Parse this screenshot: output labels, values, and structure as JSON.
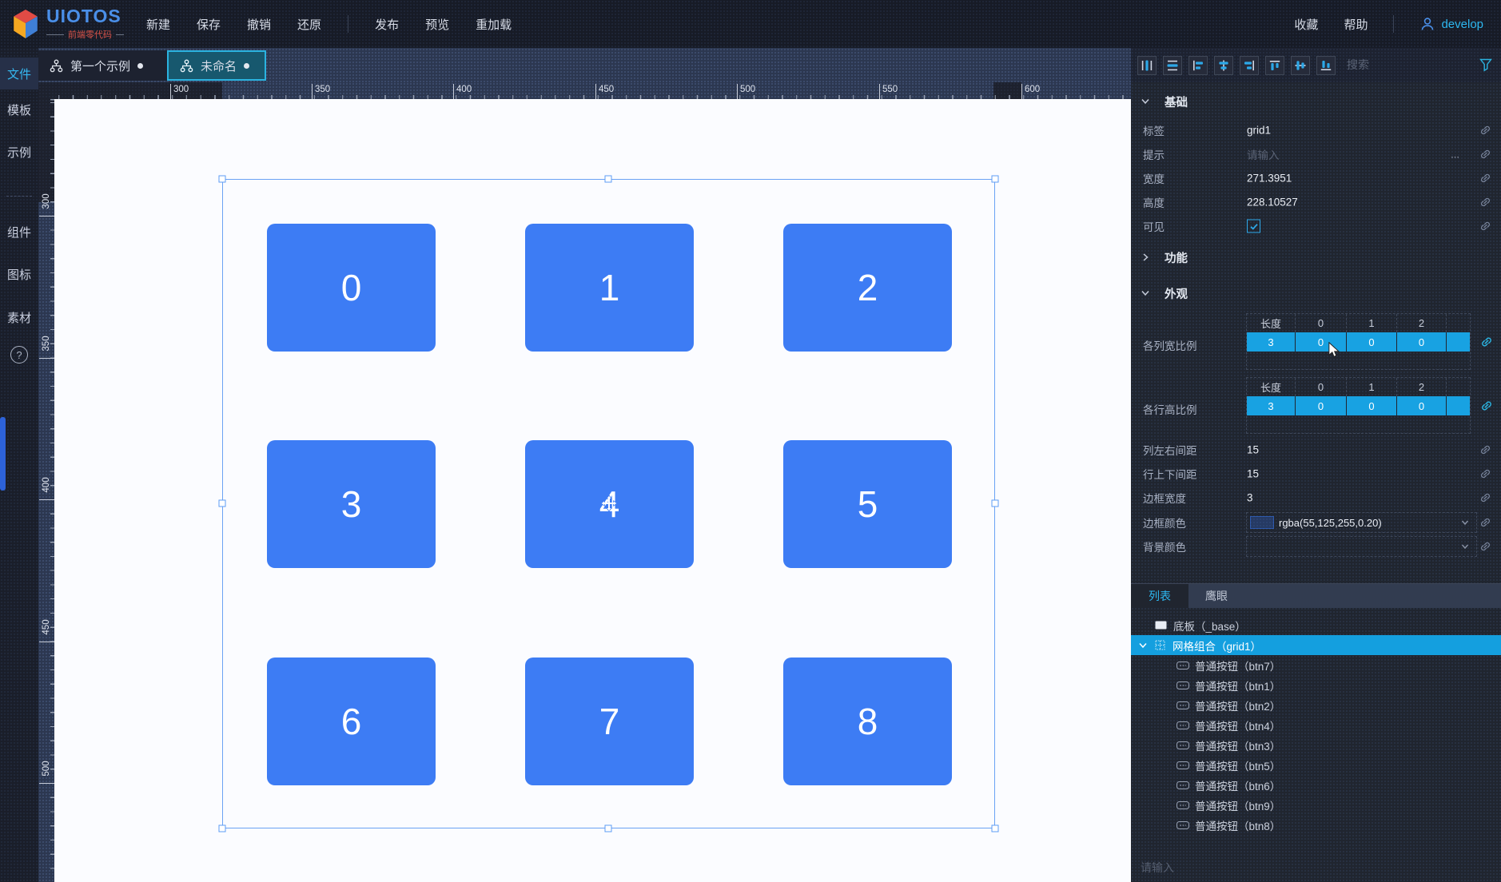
{
  "topbar": {
    "logo_title": "UIOTOS",
    "logo_subtitle": "前端零代码",
    "menu": [
      "新建",
      "保存",
      "撤销",
      "还原",
      "发布",
      "预览",
      "重加载"
    ],
    "favorites": "收藏",
    "help": "帮助",
    "user": "develop"
  },
  "sidebar": {
    "top_items": [
      "文件",
      "模板",
      "示例"
    ],
    "bottom_items": [
      "组件",
      "图标",
      "素材"
    ],
    "help_glyph": "?"
  },
  "tabs": [
    {
      "label": "第一个示例"
    },
    {
      "label": "未命名"
    }
  ],
  "rulers": {
    "horizontal": [
      "300",
      "350",
      "400",
      "450",
      "500",
      "550",
      "600"
    ],
    "vertical": [
      "300",
      "350",
      "400",
      "450",
      "500"
    ]
  },
  "canvas": {
    "button_labels": [
      "0",
      "1",
      "2",
      "3",
      "4",
      "5",
      "6",
      "7",
      "8"
    ]
  },
  "inspector": {
    "search_placeholder": "搜索",
    "sections": {
      "basic": "基础",
      "function": "功能",
      "appearance": "外观"
    },
    "basic": {
      "label_row": {
        "label": "标签",
        "value": "grid1"
      },
      "tip_row": {
        "label": "提示",
        "placeholder": "请输入",
        "more": "..."
      },
      "width_row": {
        "label": "宽度",
        "value": "271.3951"
      },
      "height_row": {
        "label": "高度",
        "value": "228.10527"
      },
      "visible_row": {
        "label": "可见"
      }
    },
    "appearance": {
      "col_ratio": {
        "label": "各列宽比例",
        "headers": [
          "长度",
          "0",
          "1",
          "2"
        ],
        "values": [
          "3",
          "0",
          "0",
          "0"
        ]
      },
      "row_ratio": {
        "label": "各行高比例",
        "headers": [
          "长度",
          "0",
          "1",
          "2"
        ],
        "values": [
          "3",
          "0",
          "0",
          "0"
        ]
      },
      "col_gap": {
        "label": "列左右间距",
        "value": "15"
      },
      "row_gap": {
        "label": "行上下间距",
        "value": "15"
      },
      "border_width": {
        "label": "边框宽度",
        "value": "3"
      },
      "border_color": {
        "label": "边框颜色",
        "value": "rgba(55,125,255,0.20)"
      },
      "bg_color": {
        "label": "背景颜色",
        "value": ""
      }
    },
    "panel_tabs": [
      "列表",
      "鹰眼"
    ],
    "tree": {
      "base": "底板（_base）",
      "group": "网格组合（grid1）",
      "children": [
        "普通按钮（btn7）",
        "普通按钮（btn1）",
        "普通按钮（btn2）",
        "普通按钮（btn4）",
        "普通按钮（btn3）",
        "普通按钮（btn5）",
        "普通按钮（btn6）",
        "普通按钮（btn9）",
        "普通按钮（btn8）"
      ]
    },
    "bottom_input_placeholder": "请输入"
  },
  "colors": {
    "accent_cyan": "#2bb3e0",
    "selection_blue": "#6aa2f4",
    "button_blue": "#3d7cf4",
    "value_row_cyan": "#18a2e2",
    "border_color_swatch": "rgba(55,125,255,0.20)"
  }
}
